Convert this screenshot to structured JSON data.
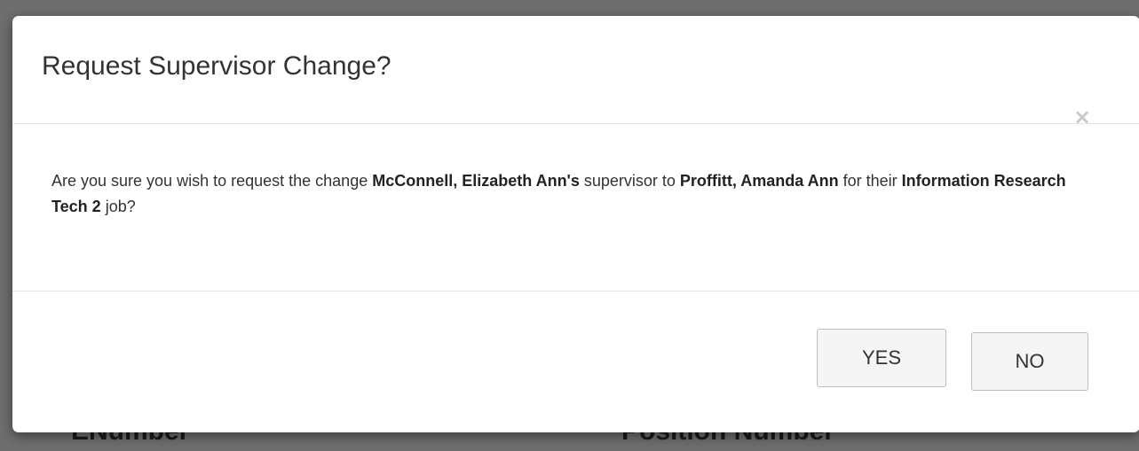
{
  "background": {
    "column_labels": [
      "ENumber",
      "Position Number"
    ]
  },
  "modal": {
    "title": "Request Supervisor Change?",
    "close_symbol": "×",
    "message": {
      "prefix": "Are you sure you wish to request the change ",
      "employee": "McConnell, Elizabeth Ann's",
      "middle": " supervisor to ",
      "new_supervisor": "Proffitt, Amanda Ann",
      "middle2": " for their ",
      "job": "Information Research Tech 2",
      "suffix": " job?"
    },
    "buttons": {
      "yes_label": "YES",
      "no_label": "NO"
    }
  }
}
